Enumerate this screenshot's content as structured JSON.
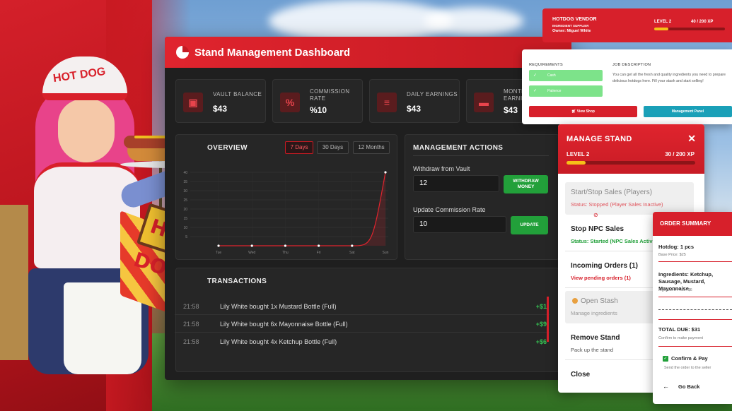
{
  "dashboard": {
    "title": "Stand Management Dashboard",
    "stats": [
      {
        "label": "VAULT BALANCE",
        "value": "$43",
        "icon": "vault-icon"
      },
      {
        "label": "COMMISSION RATE",
        "value": "%10",
        "icon": "percent-icon"
      },
      {
        "label": "DAILY EARNINGS",
        "value": "$43",
        "icon": "coins-icon"
      },
      {
        "label": "MONTHLY EARNINGS",
        "value": "$43",
        "icon": "wallet-icon"
      }
    ],
    "overview": {
      "title": "OVERVIEW",
      "ranges": [
        "7 Days",
        "30 Days",
        "12 Months"
      ],
      "active_range": "7 Days"
    },
    "management": {
      "title": "MANAGEMENT ACTIONS",
      "withdraw_label": "Withdraw from Vault",
      "withdraw_value": "12",
      "withdraw_button": "WITHDRAW MONEY",
      "commission_label": "Update Commission Rate",
      "commission_value": "10",
      "update_button": "UPDATE"
    },
    "transactions": {
      "title": "TRANSACTIONS",
      "rows": [
        {
          "time": "21:58",
          "desc": "Lily White bought 1x Mustard Bottle (Full)",
          "amount": "+$1"
        },
        {
          "time": "21:58",
          "desc": "Lily White bought 6x Mayonnaise Bottle (Full)",
          "amount": "+$9"
        },
        {
          "time": "21:58",
          "desc": "Lily White bought 4x Ketchup Bottle (Full)",
          "amount": "+$6"
        }
      ]
    }
  },
  "chart_data": {
    "type": "area",
    "categories": [
      "Tue",
      "Wed",
      "Thu",
      "Fri",
      "Sat",
      "Sun"
    ],
    "values": [
      0,
      0,
      0,
      0,
      0,
      40
    ],
    "ylim": [
      0,
      40
    ],
    "yticks": [
      5,
      10,
      15,
      20,
      25,
      30,
      35,
      40
    ],
    "xlabel": "",
    "ylabel": "",
    "grid": true,
    "color": "#e0242e"
  },
  "vendor": {
    "title": "HOTDOG VENDOR",
    "subtitle": "INGREDIENT SUPPLIER",
    "owner": "Owner: Miguel White",
    "level": "LEVEL 2",
    "xp": "40 / 200 XP",
    "progress": 0.2
  },
  "job": {
    "requirements_title": "REQUIREMENTS",
    "requirements": [
      "Cash",
      "Patience"
    ],
    "description_title": "JOB DESCRIPTION",
    "description": "You can get all the fresh and quality ingredients you need to prepare delicious hotdogs here. Fill your stash and start selling!",
    "view_shop": "View Shop",
    "management_panel": "Management Panel"
  },
  "manage": {
    "title": "MANAGE STAND",
    "level": "LEVEL 2",
    "xp": "30 / 200 XP",
    "progress": 0.15,
    "items": [
      {
        "title": "Start/Stop Sales (Players)",
        "status": "Status: Stopped (Player Sales Inactive)"
      },
      {
        "title": "Stop NPC Sales",
        "status": "Status: Started (NPC Sales Active)"
      },
      {
        "title": "Incoming Orders (1)",
        "status": "View pending orders (1)"
      },
      {
        "title": "Open Stash",
        "status": "Manage ingredients"
      },
      {
        "title": "Remove Stand",
        "status": "Pack up the stand"
      },
      {
        "title": "Close",
        "status": ""
      }
    ]
  },
  "order": {
    "title": "ORDER SUMMARY",
    "hotdog": "Hotdog: 1 pcs",
    "base_price": "Base Price: $25",
    "ingredients": "Ingredients: Ketchup, Sausage, Mustard, Mayonnaise",
    "ingredient_price": "Ingredient Price: $6",
    "total": "TOTAL DUE: $31",
    "total_sub": "Confirm to make payment",
    "confirm": "Confirm & Pay",
    "confirm_sub": "Send the order to the seller",
    "back": "Go Back"
  },
  "mascot": {
    "cap_text": "HOT DOG",
    "sign_text": "HOT DOG!"
  }
}
